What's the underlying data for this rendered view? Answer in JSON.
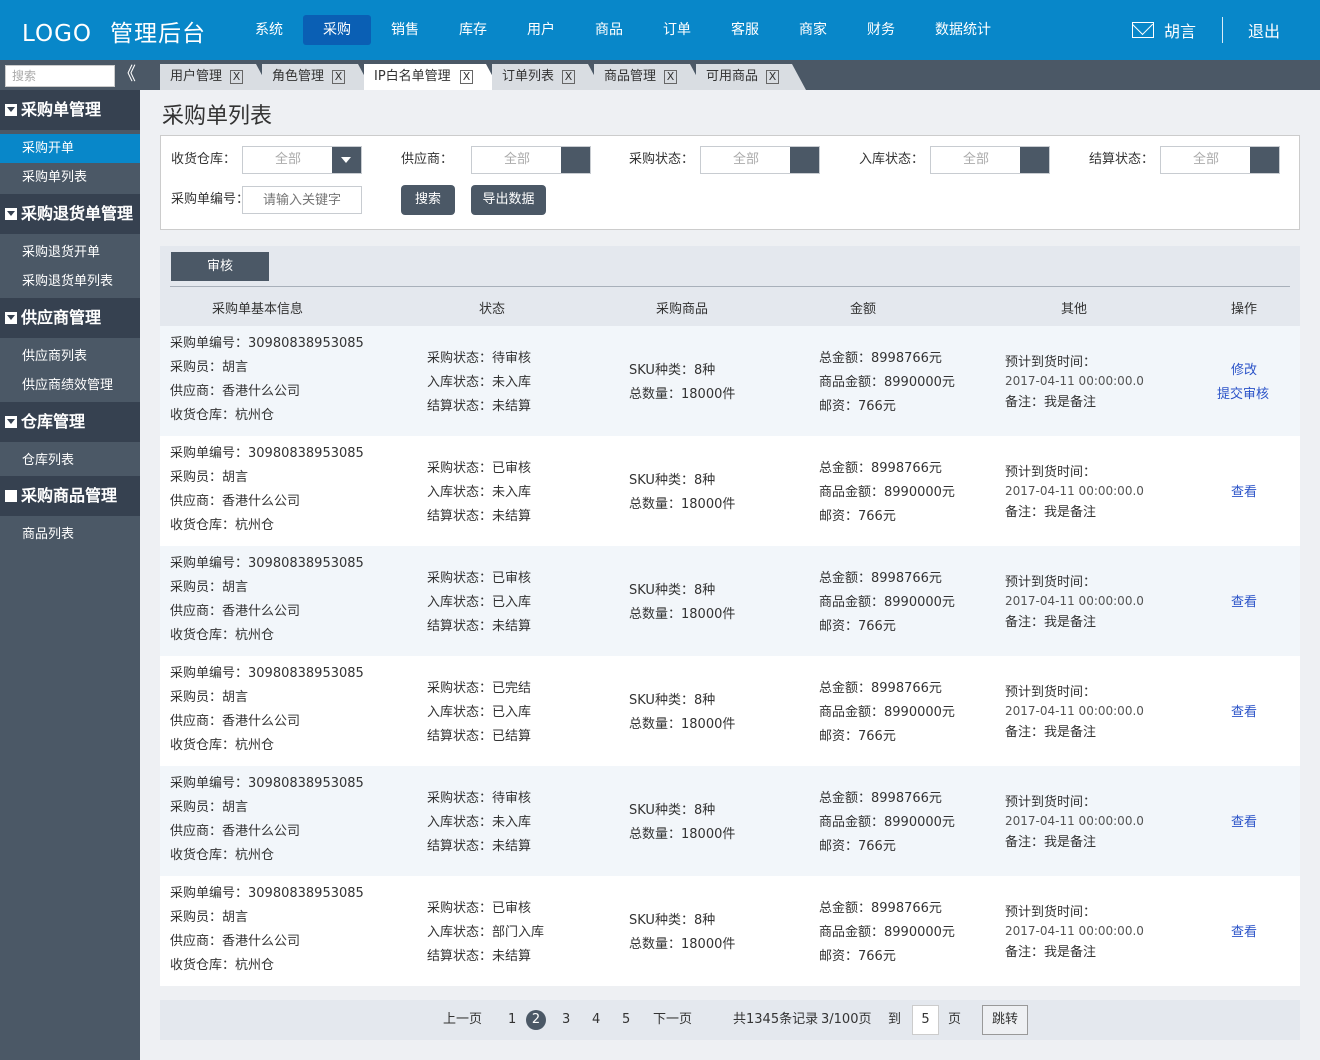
{
  "header": {
    "logo": "LOGO",
    "system_name": "管理后台",
    "nav": [
      "系统",
      "采购",
      "销售",
      "库存",
      "用户",
      "商品",
      "订单",
      "客服",
      "商家",
      "财务",
      "数据统计"
    ],
    "active_nav": "采购",
    "user_name": "胡言",
    "logout": "退出",
    "mail_icon": "mail-icon"
  },
  "sidebar": {
    "search_placeholder": "搜索",
    "collapse_icon": "《",
    "groups": [
      {
        "title": "采购单管理",
        "items": [
          "采购开单",
          "采购单列表"
        ]
      },
      {
        "title": "采购退货单管理",
        "items": [
          "采购退货开单",
          "采购退货单列表"
        ]
      },
      {
        "title": "供应商管理",
        "items": [
          "供应商列表",
          "供应商绩效管理"
        ]
      },
      {
        "title": "仓库管理",
        "items": [
          "仓库列表"
        ]
      },
      {
        "title": "采购商品管理",
        "items": [
          "商品列表"
        ]
      }
    ],
    "active_item": "采购开单"
  },
  "tabs": {
    "items": [
      "用户管理",
      "角色管理",
      "IP白名单管理",
      "订单列表",
      "商品管理",
      "可用商品"
    ],
    "close": "X",
    "active": "IP白名单管理"
  },
  "page": {
    "title": "采购单列表"
  },
  "filters": {
    "warehouse_label": "收货仓库：",
    "supplier_label": "供应商：",
    "purchase_status_label": "采购状态：",
    "stock_status_label": "入库状态：",
    "settle_status_label": "结算状态：",
    "all": "全部",
    "order_no_label": "采购单编号：",
    "order_no_placeholder": "请输入关键字",
    "search_button": "搜索",
    "export_button": "导出数据"
  },
  "list": {
    "audit_button": "审核",
    "columns": [
      "采购单基本信息",
      "状态",
      "采购商品",
      "金额",
      "其他",
      "操作"
    ],
    "rows": [
      {
        "order_no": "采购单编号：30980838953085",
        "buyer": "采购员：胡言",
        "supplier": "供应商：香港什么公司",
        "warehouse": "收货仓库：杭州仓",
        "purchase_status": "采购状态：待审核",
        "stock_status": "入库状态：未入库",
        "settle_status": "结算状态：未结算",
        "sku": "SKU种类：8种",
        "qty": "总数量：18000件",
        "total": "总金额：8998766元",
        "goods_amount": "商品金额：8990000元",
        "postage": "邮资：766元",
        "eta_label": "预计到货时间：",
        "eta": "2017-04-11 00:00:00.0",
        "remark": "备注：我是备注",
        "actions": [
          "修改",
          "提交审核"
        ]
      },
      {
        "order_no": "采购单编号：30980838953085",
        "buyer": "采购员：胡言",
        "supplier": "供应商：香港什么公司",
        "warehouse": "收货仓库：杭州仓",
        "purchase_status": "采购状态：已审核",
        "stock_status": "入库状态：未入库",
        "settle_status": "结算状态：未结算",
        "sku": "SKU种类：8种",
        "qty": "总数量：18000件",
        "total": "总金额：8998766元",
        "goods_amount": "商品金额：8990000元",
        "postage": "邮资：766元",
        "eta_label": "预计到货时间：",
        "eta": "2017-04-11 00:00:00.0",
        "remark": "备注：我是备注",
        "actions": [
          "查看"
        ]
      },
      {
        "order_no": "采购单编号：30980838953085",
        "buyer": "采购员：胡言",
        "supplier": "供应商：香港什么公司",
        "warehouse": "收货仓库：杭州仓",
        "purchase_status": "采购状态：已审核",
        "stock_status": "入库状态：已入库",
        "settle_status": "结算状态：未结算",
        "sku": "SKU种类：8种",
        "qty": "总数量：18000件",
        "total": "总金额：8998766元",
        "goods_amount": "商品金额：8990000元",
        "postage": "邮资：766元",
        "eta_label": "预计到货时间：",
        "eta": "2017-04-11 00:00:00.0",
        "remark": "备注：我是备注",
        "actions": [
          "查看"
        ]
      },
      {
        "order_no": "采购单编号：30980838953085",
        "buyer": "采购员：胡言",
        "supplier": "供应商：香港什么公司",
        "warehouse": "收货仓库：杭州仓",
        "purchase_status": "采购状态：已完结",
        "stock_status": "入库状态：已入库",
        "settle_status": "结算状态：已结算",
        "sku": "SKU种类：8种",
        "qty": "总数量：18000件",
        "total": "总金额：8998766元",
        "goods_amount": "商品金额：8990000元",
        "postage": "邮资：766元",
        "eta_label": "预计到货时间：",
        "eta": "2017-04-11 00:00:00.0",
        "remark": "备注：我是备注",
        "actions": [
          "查看"
        ]
      },
      {
        "order_no": "采购单编号：30980838953085",
        "buyer": "采购员：胡言",
        "supplier": "供应商：香港什么公司",
        "warehouse": "收货仓库：杭州仓",
        "purchase_status": "采购状态：待审核",
        "stock_status": "入库状态：未入库",
        "settle_status": "结算状态：未结算",
        "sku": "SKU种类：8种",
        "qty": "总数量：18000件",
        "total": "总金额：8998766元",
        "goods_amount": "商品金额：8990000元",
        "postage": "邮资：766元",
        "eta_label": "预计到货时间：",
        "eta": "2017-04-11 00:00:00.0",
        "remark": "备注：我是备注",
        "actions": [
          "查看"
        ]
      },
      {
        "order_no": "采购单编号：30980838953085",
        "buyer": "采购员：胡言",
        "supplier": "供应商：香港什么公司",
        "warehouse": "收货仓库：杭州仓",
        "purchase_status": "采购状态：已审核",
        "stock_status": "入库状态：部门入库",
        "settle_status": "结算状态：未结算",
        "sku": "SKU种类：8种",
        "qty": "总数量：18000件",
        "total": "总金额：8998766元",
        "goods_amount": "商品金额：8990000元",
        "postage": "邮资：766元",
        "eta_label": "预计到货时间：",
        "eta": "2017-04-11 00:00:00.0",
        "remark": "备注：我是备注",
        "actions": [
          "查看"
        ]
      }
    ]
  },
  "pager": {
    "prev": "上一页",
    "pages": [
      "1",
      "2",
      "3",
      "4",
      "5"
    ],
    "current": "2",
    "next": "下一页",
    "total": "共1345条记录",
    "page_info": "3/100页",
    "goto_label": "到",
    "goto_value": "5",
    "page_unit": "页",
    "jump": "跳转"
  }
}
